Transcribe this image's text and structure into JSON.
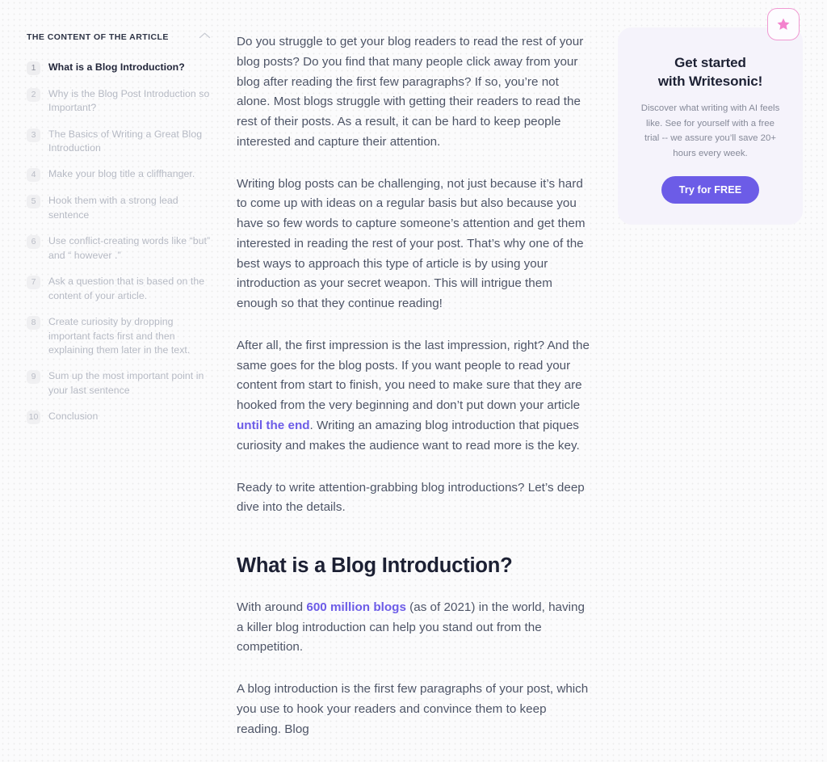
{
  "toc": {
    "title": "THE CONTENT OF THE ARTICLE",
    "collapse_icon": "chevron-up-icon",
    "items": [
      {
        "num": "1",
        "label": "What is a Blog Introduction?",
        "active": true
      },
      {
        "num": "2",
        "label": "Why is the Blog Post Introduction so Important?",
        "active": false
      },
      {
        "num": "3",
        "label": "The Basics of Writing a Great Blog Introduction",
        "active": false
      },
      {
        "num": "4",
        "label": "Make your blog title a cliffhanger.",
        "active": false
      },
      {
        "num": "5",
        "label": "Hook them with a strong lead sentence",
        "active": false
      },
      {
        "num": "6",
        "label": "Use conflict-creating words like “but” and “ however .”",
        "active": false
      },
      {
        "num": "7",
        "label": "Ask a question that is based on the content of your article.",
        "active": false
      },
      {
        "num": "8",
        "label": "Create curiosity by dropping important facts first and then explaining them later in the text.",
        "active": false
      },
      {
        "num": "9",
        "label": "Sum up the most important point in your last sentence",
        "active": false
      },
      {
        "num": "10",
        "label": "Conclusion",
        "active": false
      }
    ]
  },
  "article": {
    "paragraph_1": "Do you struggle to get your blog readers to read the rest of your blog posts? Do you find that many people click away from your blog after reading the first few paragraphs? If so, you’re not alone. Most blogs struggle with getting their readers to read the rest of their posts. As a result, it can be hard to keep people interested and capture their attention.",
    "paragraph_2": "Writing blog posts can be challenging, not just because it’s hard to come up with ideas on a regular basis but also because you have so few words to capture someone’s attention and get them interested in reading the rest of your post. That’s why one of the best ways to approach this type of article is by using your introduction as your secret weapon. This will intrigue them enough so that they continue reading!",
    "paragraph_3_part1": "After all, the first impression is the last impression, right? And the same goes for the blog posts. If you want people to read your content from start to finish, you need to make sure that they are hooked from the very beginning and don’t put down your article ",
    "paragraph_3_link": "until the end",
    "paragraph_3_part2": ". Writing an amazing blog introduction that piques curiosity and makes the audience want to read more is the key.",
    "paragraph_4": "Ready to write attention-grabbing blog introductions? Let’s deep dive into the details.",
    "heading": "What is a Blog Introduction?",
    "paragraph_5_part1": "With around ",
    "paragraph_5_link": "600 million blogs",
    "paragraph_5_part2": " (as of 2021) in the world, having a killer blog introduction can help you stand out from the competition.",
    "paragraph_6": "A blog introduction is the first few paragraphs of your post, which you use to hook your readers and convince them to keep reading. Blog",
    "link_color": "#6c5ce7"
  },
  "promo": {
    "badge_icon": "star-icon",
    "title_line_1": "Get started",
    "title_line_2": "with Writesonic!",
    "description": "Discover what writing with AI feels like. See for yourself with a free trial -- we assure you’ll save 20+ hours every week.",
    "cta_label": "Try for FREE",
    "cta_color": "#6c5ce7",
    "card_color": "#f5f3fb",
    "badge_border_color": "#f09ad2",
    "sparkle_left_color": "#ef7fc8",
    "sparkle_right_color": "#6c5ce7"
  }
}
